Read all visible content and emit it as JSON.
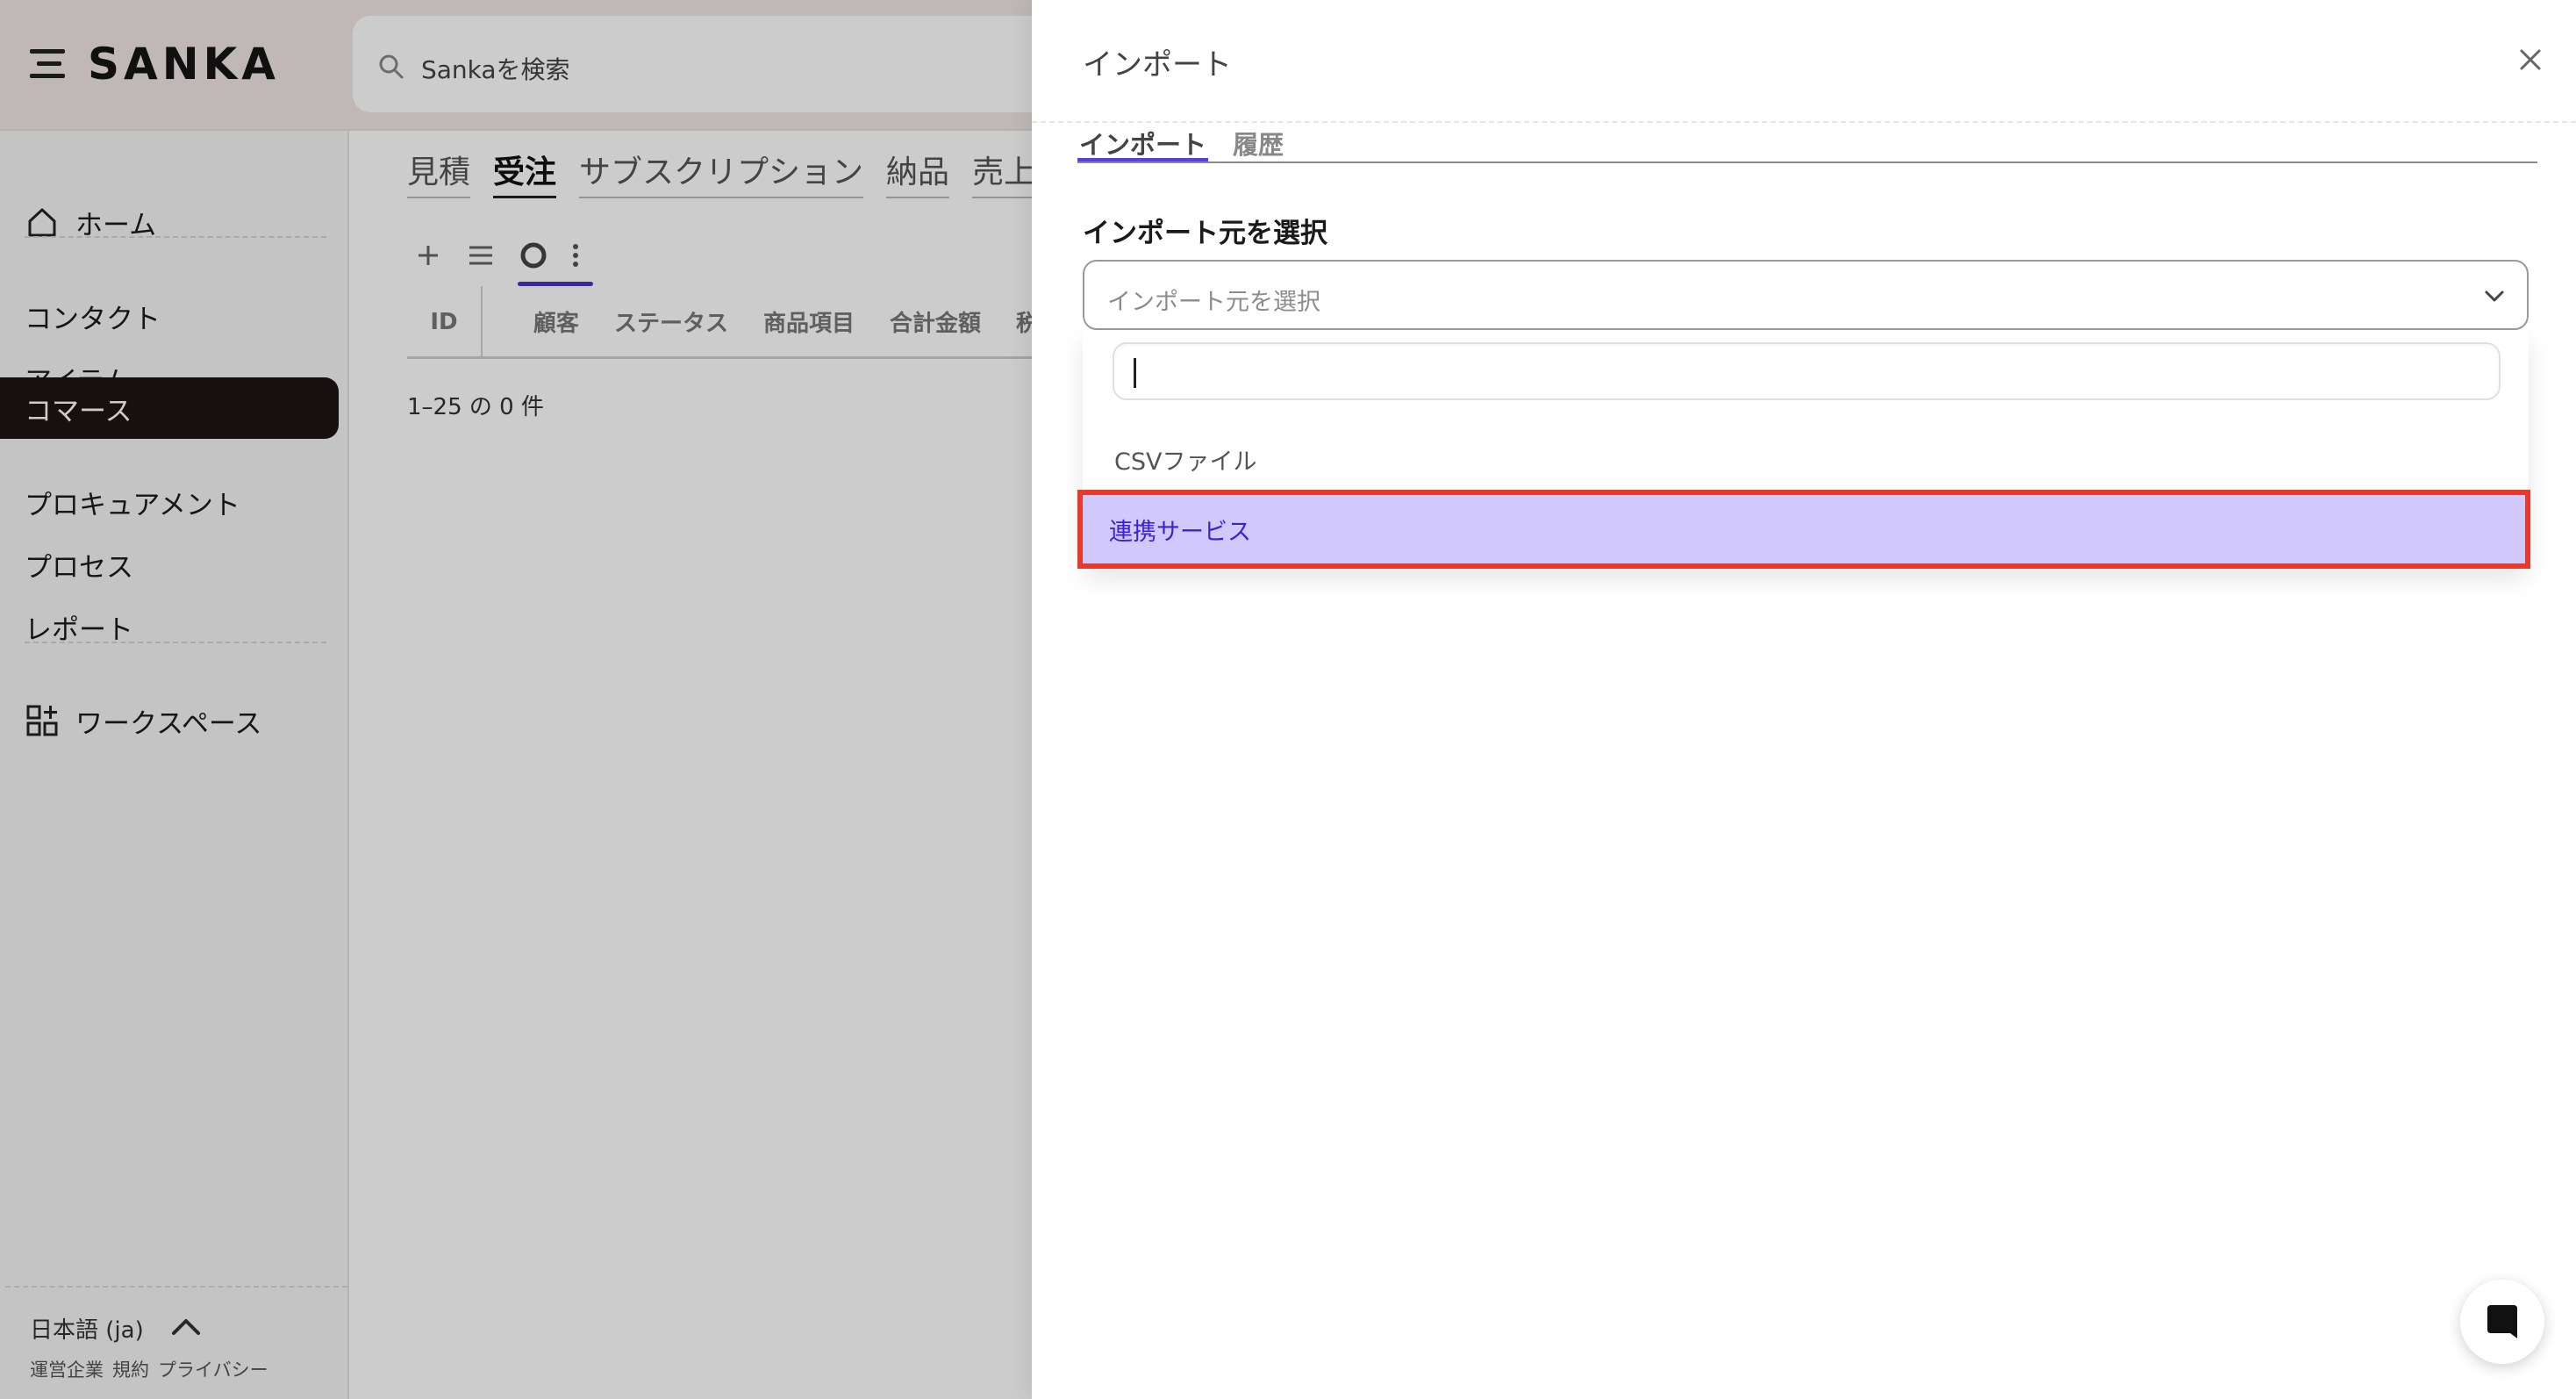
{
  "app": {
    "brand": "SANKA",
    "search_placeholder": "Sankaを検索"
  },
  "sidebar": {
    "home": "ホーム",
    "items": [
      "コンタクト",
      "アイテム",
      "コマース",
      "プロキュアメント",
      "プロセス",
      "レポート"
    ],
    "active_item": "コマース",
    "workspace": "ワークスペース",
    "language": "日本語 (ja)",
    "footer_links": [
      "運営企業",
      "規約",
      "プライバシー"
    ]
  },
  "main": {
    "module_tabs": [
      "見積",
      "受注",
      "サブスクリプション",
      "納品",
      "売上"
    ],
    "active_module_tab": "受注",
    "columns": [
      "ID",
      "顧客",
      "ステータス",
      "商品項目",
      "合計金額",
      "税"
    ],
    "record_count": "1–25 の 0 件"
  },
  "drawer": {
    "title": "インポート",
    "tabs": [
      "インポート",
      "履歴"
    ],
    "active_tab": "インポート",
    "field_label": "インポート元を選択",
    "select_placeholder": "インポート元を選択",
    "search_value": "",
    "options": [
      "CSVファイル",
      "連携サービス"
    ],
    "highlighted_option": "連携サービス"
  },
  "colors": {
    "accent": "#4a2fdc",
    "highlight_bg": "#d1c9fc",
    "highlight_border": "#e63a2c",
    "active_nav_bg": "#1d1513",
    "header_bg": "#efe7e4"
  }
}
